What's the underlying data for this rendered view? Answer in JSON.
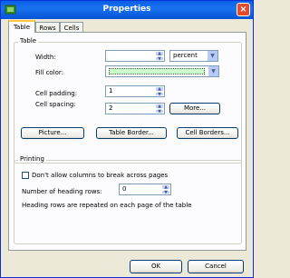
{
  "window": {
    "title": "Properties",
    "close_glyph": "×"
  },
  "tabs": [
    {
      "label": "Table",
      "active": true
    },
    {
      "label": "Rows",
      "active": false
    },
    {
      "label": "Cells",
      "active": false
    }
  ],
  "table_group": {
    "legend": "Table",
    "width": {
      "label": "Width:",
      "value": "",
      "unit": "percent"
    },
    "fill_color": {
      "label": "Fill color:",
      "swatch": "#ccffcc"
    },
    "cell_padding": {
      "label": "Cell padding:",
      "value": "1"
    },
    "cell_spacing": {
      "label": "Cell spacing:",
      "value": "2"
    },
    "more_button": "More..."
  },
  "buttons": {
    "picture": "Picture...",
    "table_border": "Table Border...",
    "cell_borders": "Cell Borders...",
    "ok": "OK",
    "cancel": "Cancel"
  },
  "printing_group": {
    "legend": "Printing",
    "no_break": {
      "label": "Don't allow columns to break across pages",
      "checked": false
    },
    "heading_rows": {
      "label": "Number of heading rows:",
      "value": "0"
    },
    "note": "Heading rows are repeated on each page of the table"
  },
  "colors": {
    "titlebar": "#0a5fe6",
    "fill_swatch": "#ccffcc",
    "tab_highlight": "#ffc83c"
  }
}
